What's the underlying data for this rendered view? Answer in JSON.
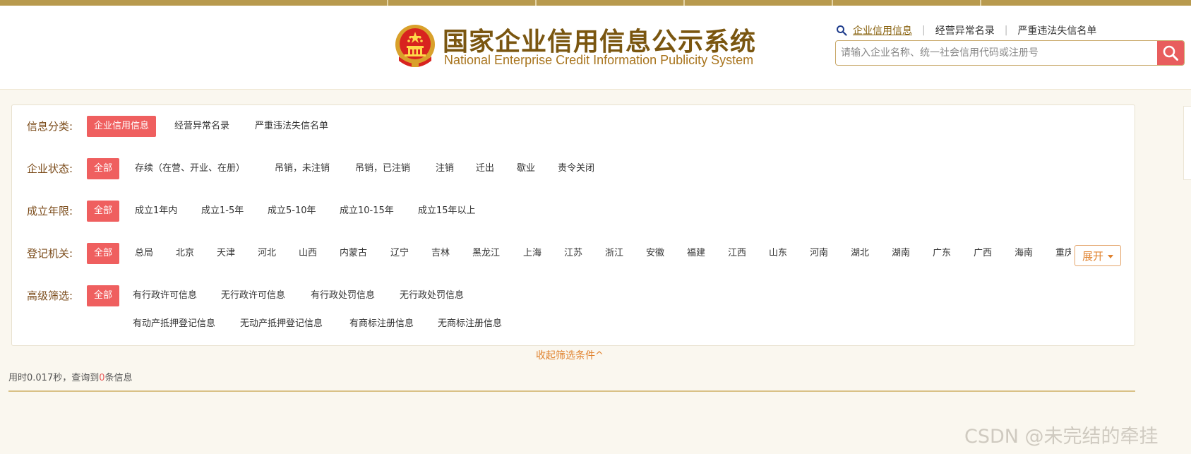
{
  "header": {
    "title_cn": "国家企业信用信息公示系统",
    "title_en": "National Enterprise Credit Information Publicity System",
    "quicknav": {
      "items": [
        "企业信用信息",
        "经营异常名录",
        "严重违法失信名单"
      ],
      "active_index": 0
    },
    "search": {
      "placeholder": "请输入企业名称、统一社会信用代码或注册号",
      "value": ""
    },
    "icons": {
      "search_small": "search-icon",
      "search_button": "search-icon",
      "emblem": "national-emblem"
    }
  },
  "filters": {
    "category": {
      "label": "信息分类:",
      "options": [
        "企业信用信息",
        "经营异常名录",
        "严重违法失信名单"
      ],
      "selected": "企业信用信息"
    },
    "status": {
      "label": "企业状态:",
      "options": [
        "全部",
        "存续（在营、开业、在册）",
        "吊销，未注销",
        "吊销，已注销",
        "注销",
        "迁出",
        "歇业",
        "责令关闭"
      ],
      "selected": "全部"
    },
    "years": {
      "label": "成立年限:",
      "options": [
        "全部",
        "成立1年内",
        "成立1-5年",
        "成立5-10年",
        "成立10-15年",
        "成立15年以上"
      ],
      "selected": "全部"
    },
    "authority": {
      "label": "登记机关:",
      "options": [
        "全部",
        "总局",
        "北京",
        "天津",
        "河北",
        "山西",
        "内蒙古",
        "辽宁",
        "吉林",
        "黑龙江",
        "上海",
        "江苏",
        "浙江",
        "安徽",
        "福建",
        "江西",
        "山东",
        "河南",
        "湖北",
        "湖南",
        "广东",
        "广西",
        "海南",
        "重庆"
      ],
      "selected": "全部",
      "expand_label": "展开"
    },
    "advanced": {
      "label": "高级筛选:",
      "options_row1": [
        "全部",
        "有行政许可信息",
        "无行政许可信息",
        "有行政处罚信息",
        "无行政处罚信息"
      ],
      "options_row2": [
        "有动产抵押登记信息",
        "无动产抵押登记信息",
        "有商标注册信息",
        "无商标注册信息"
      ],
      "selected": "全部"
    }
  },
  "collapse_label": "收起筛选条件^",
  "result": {
    "prefix": "用时0.017秒，查询到",
    "count": "0",
    "suffix": "条信息"
  },
  "watermark": "CSDN @未完结的牵挂",
  "colors": {
    "accent_red": "#ef5f5f",
    "brand_brown": "#7a5610",
    "label_brown": "#7a4a18",
    "orange": "#e0822e"
  }
}
